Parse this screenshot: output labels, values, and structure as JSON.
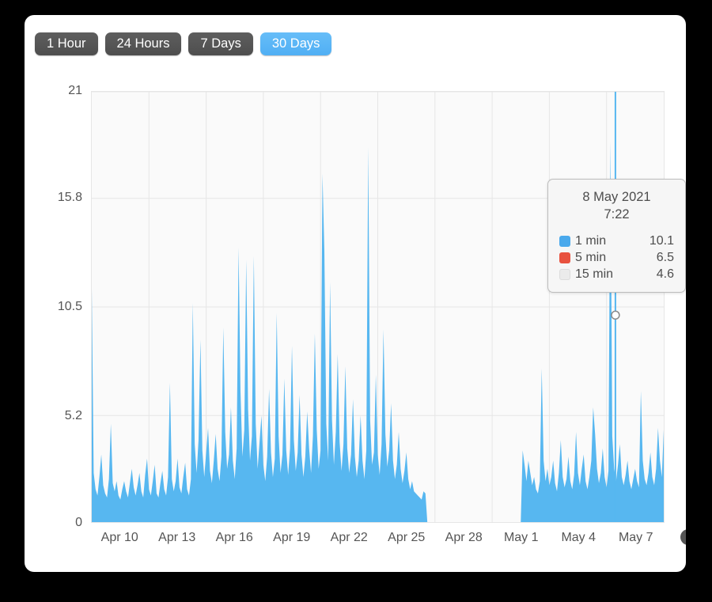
{
  "toolbar": {
    "buttons": [
      {
        "label": "1 Hour",
        "active": false
      },
      {
        "label": "24 Hours",
        "active": false
      },
      {
        "label": "7 Days",
        "active": false
      },
      {
        "label": "30 Days",
        "active": true
      }
    ]
  },
  "tooltip": {
    "date": "8 May 2021",
    "time": "7:22",
    "rows": [
      {
        "name": "1 min",
        "value": "10.1",
        "color": "#4aa9ec"
      },
      {
        "name": "5 min",
        "value": "6.5",
        "color": "#e8523f"
      },
      {
        "name": "15 min",
        "value": "4.6",
        "color": "#ebebeb"
      }
    ]
  },
  "axis_icon": "clock-icon",
  "colors": {
    "series_1min": "#57b7f0",
    "series_5min": "#e8523f",
    "series_15min": "#ebebeb",
    "accent_active": "#5bb8f5",
    "button": "#555555",
    "plot_bg": "#fafafa",
    "grid": "#e6e6e6",
    "card": "#ffffff",
    "page_bg": "#000000"
  },
  "chart_data": {
    "type": "area",
    "title": "",
    "xlabel": "",
    "ylabel": "",
    "grid": true,
    "legend_position": "tooltip",
    "ylim": [
      0,
      21
    ],
    "yticks": [
      0,
      5.2,
      10.5,
      15.8,
      21
    ],
    "ytick_labels": [
      "0",
      "5.2",
      "10.5",
      "15.8",
      "21"
    ],
    "xticks": [
      "Apr 10",
      "Apr 13",
      "Apr 16",
      "Apr 19",
      "Apr 22",
      "Apr 25",
      "Apr 28",
      "May 1",
      "May 4",
      "May 7"
    ],
    "x_range": [
      "Apr 10",
      "May 9"
    ],
    "highlight": {
      "x_label": "8 May 2021 7:22",
      "x_frac": 0.9155,
      "y": 10.1
    },
    "gap_note": "no data between approx Apr 27 and May 3",
    "series": [
      {
        "name": "1 min",
        "color": "#57b7f0",
        "values": [
          11.4,
          2.4,
          1.6,
          1.3,
          2.2,
          3.3,
          1.8,
          1.4,
          1.2,
          2.1,
          4.8,
          1.9,
          1.5,
          2.0,
          1.3,
          1.1,
          1.6,
          2.0,
          1.5,
          1.2,
          1.9,
          2.6,
          1.7,
          1.3,
          1.8,
          2.4,
          1.5,
          1.2,
          2.3,
          3.1,
          1.6,
          1.3,
          2.0,
          2.8,
          1.4,
          1.2,
          1.9,
          2.5,
          1.6,
          1.3,
          2.2,
          6.8,
          2.1,
          1.5,
          2.0,
          3.1,
          1.7,
          1.4,
          2.2,
          2.9,
          1.6,
          1.3,
          2.1,
          10.7,
          3.8,
          2.4,
          4.0,
          8.9,
          3.5,
          2.2,
          3.4,
          4.6,
          2.5,
          1.9,
          3.0,
          4.3,
          2.6,
          2.0,
          3.2,
          9.5,
          4.4,
          2.6,
          3.3,
          5.6,
          3.0,
          2.1,
          3.6,
          13.4,
          6.4,
          3.2,
          4.5,
          12.8,
          5.5,
          3.0,
          4.2,
          13.0,
          4.8,
          2.6,
          3.9,
          5.2,
          2.8,
          2.0,
          3.2,
          6.5,
          3.4,
          2.2,
          3.1,
          10.2,
          4.2,
          2.4,
          3.3,
          7.0,
          3.5,
          2.3,
          3.6,
          8.6,
          4.0,
          2.5,
          3.4,
          6.2,
          3.3,
          2.2,
          3.2,
          5.4,
          3.6,
          2.4,
          4.2,
          9.2,
          4.5,
          2.6,
          3.5,
          17.0,
          13.2,
          4.8,
          3.0,
          11.7,
          5.0,
          2.8,
          4.4,
          8.2,
          3.9,
          2.5,
          3.8,
          7.6,
          3.6,
          2.4,
          3.3,
          6.0,
          3.2,
          2.2,
          3.0,
          5.2,
          3.0,
          2.1,
          3.5,
          18.3,
          5.0,
          2.8,
          3.4,
          7.2,
          3.3,
          2.3,
          3.8,
          9.4,
          4.3,
          2.7,
          3.5,
          5.8,
          3.0,
          2.1,
          2.8,
          4.4,
          2.6,
          1.9,
          2.5,
          3.4,
          2.1,
          1.6,
          2.0,
          1.5,
          1.4,
          1.3,
          1.2,
          1.1,
          1.5,
          1.4,
          0,
          0,
          0,
          0,
          0,
          0,
          0,
          0,
          0,
          0,
          0,
          0,
          0,
          0,
          0,
          0,
          0,
          0,
          0,
          0,
          0,
          0,
          0,
          0,
          0,
          0,
          0,
          0,
          0,
          0,
          0,
          0,
          0,
          0,
          0,
          0,
          0,
          0,
          0,
          0,
          0,
          0,
          0,
          0,
          0,
          0,
          0,
          0,
          0,
          0,
          3.5,
          2.8,
          2.0,
          3.0,
          2.4,
          1.8,
          2.2,
          1.6,
          1.4,
          2.0,
          7.5,
          3.0,
          2.0,
          2.6,
          1.8,
          2.2,
          3.0,
          1.9,
          1.5,
          2.4,
          4.0,
          2.2,
          1.7,
          2.1,
          3.2,
          2.0,
          1.6,
          2.3,
          4.4,
          2.4,
          1.8,
          2.6,
          3.3,
          2.0,
          1.6,
          2.2,
          3.0,
          5.6,
          4.3,
          2.6,
          1.9,
          2.4,
          3.6,
          2.2,
          1.7,
          2.5,
          18.6,
          4.2,
          2.6,
          2.0,
          2.8,
          3.8,
          2.2,
          1.8,
          2.3,
          3.0,
          2.0,
          1.6,
          2.1,
          2.6,
          2.0,
          1.7,
          6.4,
          3.0,
          2.1,
          1.8,
          2.4,
          3.4,
          2.2,
          1.8,
          2.6,
          4.6,
          3.0,
          2.2,
          4.5
        ]
      }
    ]
  }
}
